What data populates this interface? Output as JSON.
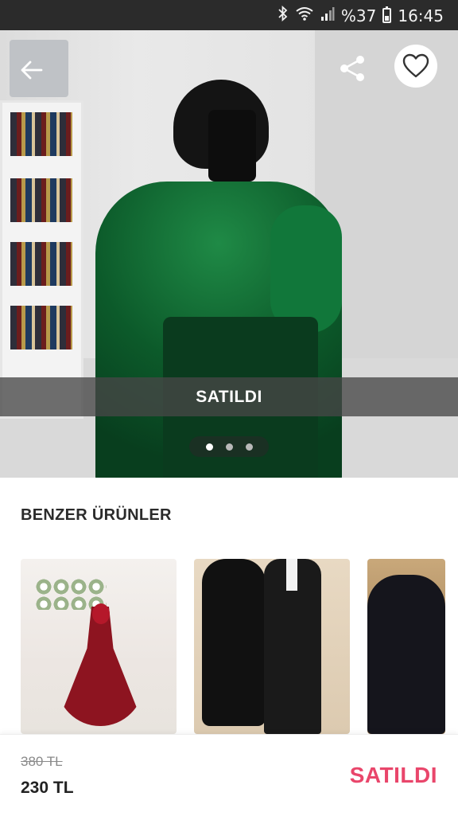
{
  "status_bar": {
    "battery_text": "%37",
    "time": "16:45",
    "icons": [
      "bluetooth-icon",
      "wifi-icon",
      "signal-icon",
      "battery-icon"
    ]
  },
  "hero": {
    "sold_label": "SATILDI",
    "carousel": {
      "total": 3,
      "active_index": 0
    },
    "icons": {
      "back": "back-arrow-icon",
      "share": "share-icon",
      "favorite": "heart-icon"
    }
  },
  "similar": {
    "title": "BENZER ÜRÜNLER",
    "items": [
      {
        "image": "red-evening-gown"
      },
      {
        "image": "black-gown-and-suit-couple"
      },
      {
        "image": "black-embellished-gown"
      }
    ]
  },
  "bottom": {
    "old_price": "380 TL",
    "new_price": "230 TL",
    "status_label": "SATILDI"
  },
  "colors": {
    "accent": "#e9466b",
    "status_bar": "#2b2b2b",
    "overlay": "#464646"
  }
}
